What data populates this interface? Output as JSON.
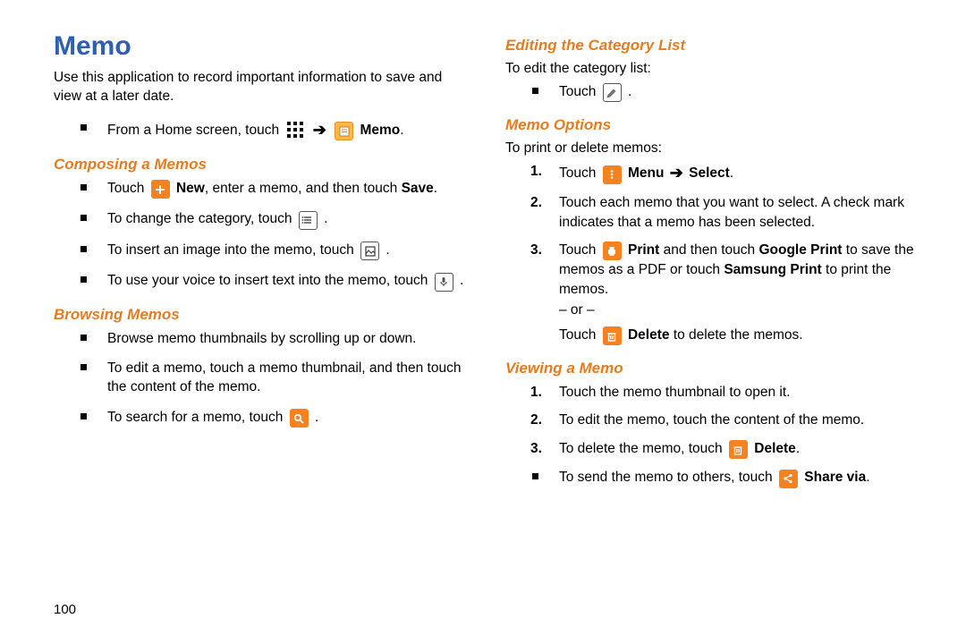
{
  "page_number": "100",
  "title": "Memo",
  "intro": "Use this application to record important information to save and view at a later date.",
  "from_home_prefix": "From a Home screen, touch ",
  "memo_label": "Memo",
  "sections": {
    "composing": {
      "heading": "Composing a Memos",
      "items": {
        "new_prefix": "Touch ",
        "new_label": " New",
        "new_suffix": ", enter a memo, and then touch ",
        "save_label": "Save",
        "category": "To change the category, touch ",
        "image": "To insert an image into the memo, touch ",
        "voice": "To use your voice to insert text into the memo, touch "
      }
    },
    "browsing": {
      "heading": "Browsing Memos",
      "items": {
        "scroll": "Browse memo thumbnails by scrolling up or down.",
        "edit": "To edit a memo, touch a memo thumbnail, and then touch the content of the memo.",
        "search": "To search for a memo, touch "
      }
    },
    "editing_cat": {
      "heading": "Editing the Category List",
      "intro": "To edit the category list:",
      "touch": "Touch "
    },
    "options": {
      "heading": "Memo Options",
      "intro": "To print or delete memos:",
      "step1_prefix": "Touch ",
      "menu_label": " Menu ",
      "select_label": " Select",
      "step2": "Touch each memo that you want to select. A check mark indicates that a memo has been selected.",
      "step3_prefix": "Touch ",
      "print_label": " Print",
      "step3_mid": " and then touch ",
      "gprint_label": "Google Print",
      "step3_mid2": " to save the memos as a PDF or touch ",
      "sprint_label": "Samsung Print",
      "step3_suffix": " to print the memos.",
      "or_text": "– or –",
      "delete_prefix": "Touch ",
      "delete_label": " Delete",
      "delete_suffix": " to delete the memos."
    },
    "viewing": {
      "heading": "Viewing a Memo",
      "step1": "Touch the memo thumbnail to open it.",
      "step2": "To edit the memo, touch the content of the memo.",
      "step3_prefix": "To delete the memo, touch ",
      "step3_label": " Delete",
      "send_prefix": "To send the memo to others, touch ",
      "send_label": " Share via"
    }
  },
  "period": "."
}
